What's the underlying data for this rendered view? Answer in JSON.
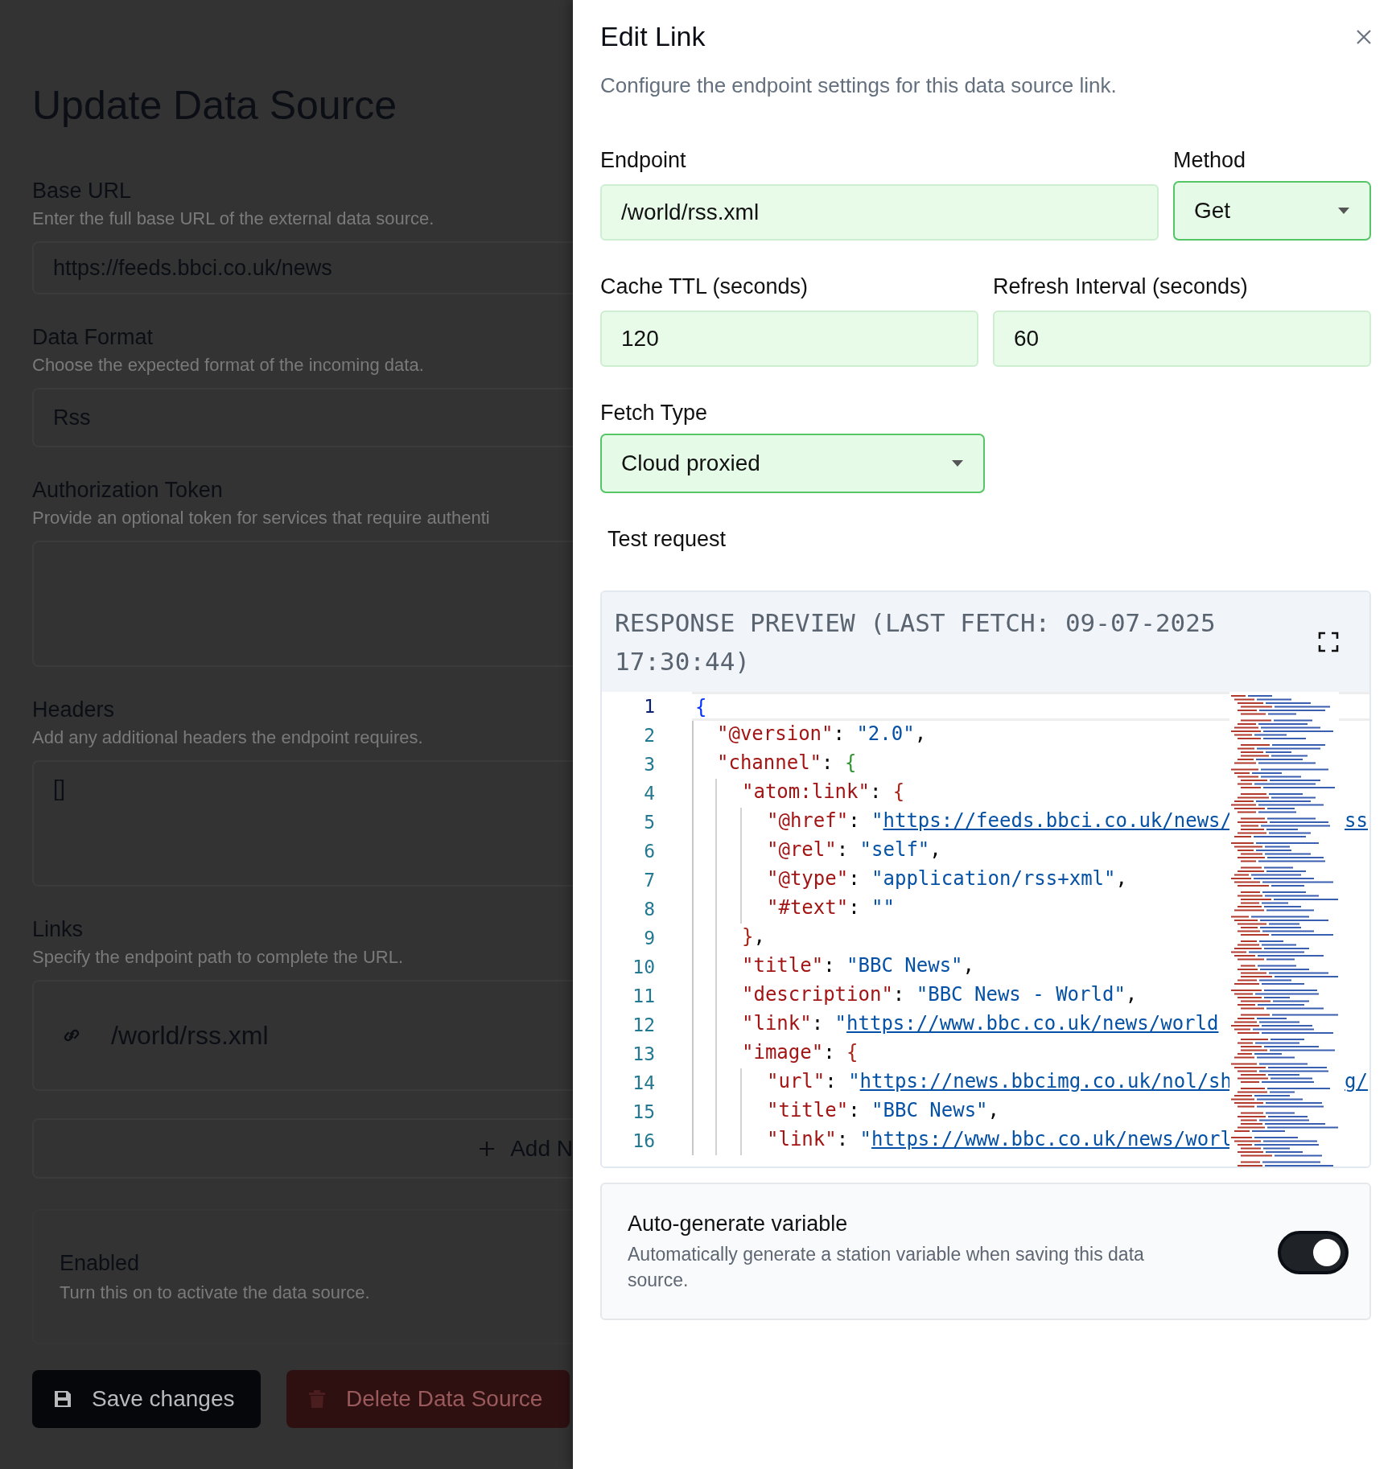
{
  "page": {
    "title": "Update Data Source",
    "fields": [
      {
        "kind": "input",
        "label": "Base URL",
        "description": "Enter the full base URL of the external data source.",
        "value": "https://feeds.bbci.co.uk/news"
      },
      {
        "kind": "select",
        "label": "Data Format",
        "description": "Choose the expected format of the incoming data.",
        "value": "Rss"
      },
      {
        "kind": "textarea",
        "label": "Authorization Token",
        "description": "Provide an optional token for services that require authenti"
      },
      {
        "kind": "textarea",
        "label": "Headers",
        "description": "Add any additional headers the endpoint requires.",
        "value": "[]"
      },
      {
        "kind": "links",
        "label": "Links",
        "description": "Specify the endpoint path to complete the URL.",
        "links": [
          "/world/rss.xml"
        ],
        "add_label": "Add N"
      }
    ],
    "enabled": {
      "title": "Enabled",
      "description": "Turn this on to activate the data source."
    },
    "buttons": [
      {
        "kind": "primary",
        "label": "Save changes"
      },
      {
        "kind": "danger",
        "label": "Delete Data Source"
      }
    ]
  },
  "drawer": {
    "title": "Edit Link",
    "description": "Configure the endpoint settings for this data source link.",
    "endpoint": {
      "label": "Endpoint",
      "value": "/world/rss.xml"
    },
    "method": {
      "label": "Method",
      "value": "Get"
    },
    "cache_ttl": {
      "label": "Cache TTL (seconds)",
      "value": "120"
    },
    "refresh_interval": {
      "label": "Refresh Interval (seconds)",
      "value": "60"
    },
    "fetch_type": {
      "label": "Fetch Type",
      "value": "Cloud proxied"
    },
    "test_request": "Test request",
    "preview": {
      "title": "RESPONSE PREVIEW (LAST FETCH: 09-07-2025 17:30:44)",
      "lines": [
        {
          "n": "1",
          "current": true,
          "tokens": [
            {
              "kind": "bracket",
              "color": "#0431fa",
              "text": "{"
            }
          ]
        },
        {
          "n": "2",
          "current": false,
          "tokens": [
            {
              "kind": "key",
              "text": "  \"@version\""
            },
            {
              "kind": "punct",
              "text": ": "
            },
            {
              "kind": "string",
              "text": "\"2.0\""
            },
            {
              "kind": "punct",
              "text": ","
            }
          ]
        },
        {
          "n": "3",
          "current": false,
          "tokens": [
            {
              "kind": "key",
              "text": "  \"channel\""
            },
            {
              "kind": "punct",
              "text": ": "
            },
            {
              "kind": "bracket",
              "color": "#319331",
              "text": "{"
            }
          ]
        },
        {
          "n": "4",
          "current": false,
          "tokens": [
            {
              "kind": "key",
              "text": "    \"atom:link\""
            },
            {
              "kind": "punct",
              "text": ": "
            },
            {
              "kind": "bracket",
              "color": "#a8261a",
              "text": "{"
            }
          ]
        },
        {
          "n": "5",
          "current": false,
          "tokens": [
            {
              "kind": "key",
              "text": "      \"@href\""
            },
            {
              "kind": "punct",
              "text": ": "
            },
            {
              "kind": "string",
              "text": "\""
            },
            {
              "kind": "link",
              "text": "https://feeds.bbci.co.uk/news/"
            }
          ],
          "tail": "ss"
        },
        {
          "n": "6",
          "current": false,
          "tokens": [
            {
              "kind": "key",
              "text": "      \"@rel\""
            },
            {
              "kind": "punct",
              "text": ": "
            },
            {
              "kind": "string",
              "text": "\"self\""
            },
            {
              "kind": "punct",
              "text": ","
            }
          ]
        },
        {
          "n": "7",
          "current": false,
          "tokens": [
            {
              "kind": "key",
              "text": "      \"@type\""
            },
            {
              "kind": "punct",
              "text": ": "
            },
            {
              "kind": "string",
              "text": "\"application/rss+xml\""
            },
            {
              "kind": "punct",
              "text": ","
            }
          ]
        },
        {
          "n": "8",
          "current": false,
          "tokens": [
            {
              "kind": "key",
              "text": "      \"#text\""
            },
            {
              "kind": "punct",
              "text": ": "
            },
            {
              "kind": "string",
              "text": "\"\""
            }
          ]
        },
        {
          "n": "9",
          "current": false,
          "tokens": [
            {
              "kind": "bracket",
              "color": "#a8261a",
              "text": "    }"
            },
            {
              "kind": "punct",
              "text": ","
            }
          ]
        },
        {
          "n": "10",
          "current": false,
          "tokens": [
            {
              "kind": "key",
              "text": "    \"title\""
            },
            {
              "kind": "punct",
              "text": ": "
            },
            {
              "kind": "string",
              "text": "\"BBC News\""
            },
            {
              "kind": "punct",
              "text": ","
            }
          ]
        },
        {
          "n": "11",
          "current": false,
          "tokens": [
            {
              "kind": "key",
              "text": "    \"description\""
            },
            {
              "kind": "punct",
              "text": ": "
            },
            {
              "kind": "string",
              "text": "\"BBC News - World\""
            },
            {
              "kind": "punct",
              "text": ","
            }
          ]
        },
        {
          "n": "12",
          "current": false,
          "tokens": [
            {
              "kind": "key",
              "text": "    \"link\""
            },
            {
              "kind": "punct",
              "text": ": "
            },
            {
              "kind": "string",
              "text": "\""
            },
            {
              "kind": "link",
              "text": "https://www.bbc.co.uk/news/world"
            }
          ]
        },
        {
          "n": "13",
          "current": false,
          "tokens": [
            {
              "kind": "key",
              "text": "    \"image\""
            },
            {
              "kind": "punct",
              "text": ": "
            },
            {
              "kind": "bracket",
              "color": "#a8261a",
              "text": "{"
            }
          ]
        },
        {
          "n": "14",
          "current": false,
          "tokens": [
            {
              "kind": "key",
              "text": "      \"url\""
            },
            {
              "kind": "punct",
              "text": ": "
            },
            {
              "kind": "string",
              "text": "\""
            },
            {
              "kind": "link",
              "text": "https://news.bbcimg.co.uk/nol/sh"
            }
          ],
          "tail": "g/"
        },
        {
          "n": "15",
          "current": false,
          "tokens": [
            {
              "kind": "key",
              "text": "      \"title\""
            },
            {
              "kind": "punct",
              "text": ": "
            },
            {
              "kind": "string",
              "text": "\"BBC News\""
            },
            {
              "kind": "punct",
              "text": ","
            }
          ]
        },
        {
          "n": "16",
          "current": false,
          "tokens": [
            {
              "kind": "key",
              "text": "      \"link\""
            },
            {
              "kind": "punct",
              "text": ": "
            },
            {
              "kind": "string",
              "text": "\""
            },
            {
              "kind": "link",
              "text": "https://www.bbc.co.uk/news/worl"
            }
          ]
        }
      ]
    },
    "auto_generate": {
      "title": "Auto-generate variable",
      "description": "Automatically generate a station variable when saving this data source.",
      "on": true
    }
  }
}
